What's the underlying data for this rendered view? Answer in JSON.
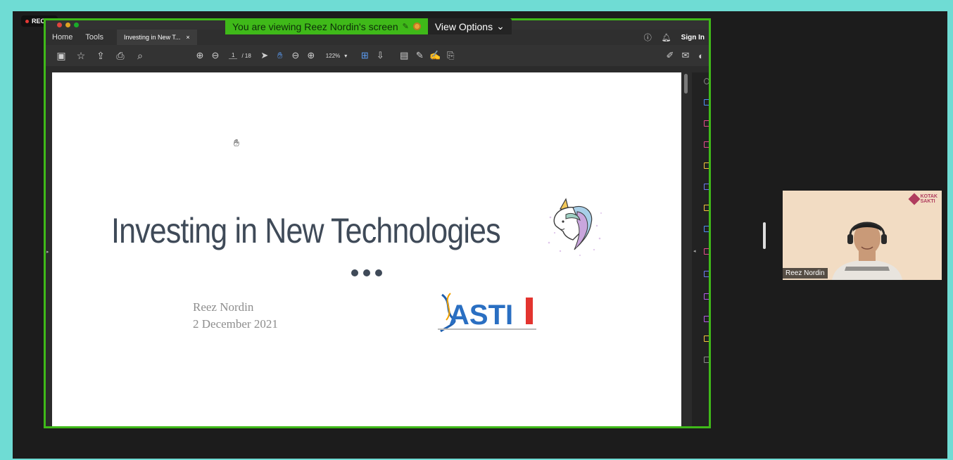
{
  "recording": {
    "label": "REC"
  },
  "banner": {
    "viewing_text": "You are viewing Reez Nordin's screen",
    "view_options_label": "View Options"
  },
  "acrobat": {
    "menu": {
      "home": "Home",
      "tools": "Tools"
    },
    "doc_tab": {
      "label": "Investing in New T...",
      "close": "×"
    },
    "sign_in": "Sign In",
    "page_current": "1",
    "page_total": "/ 18",
    "zoom": "122%"
  },
  "slide": {
    "title": "Investing in New Technologies",
    "presenter_name": "Reez Nordin",
    "date": "2 December 2021",
    "logo_text": "ASTI"
  },
  "participant": {
    "name": "Reez Nordin",
    "brand": "KOTAK\nSAKTI"
  },
  "colors": {
    "frame_border": "#3fb919",
    "outer_background": "#6fdcd4",
    "slide_text": "#3f4a58"
  }
}
